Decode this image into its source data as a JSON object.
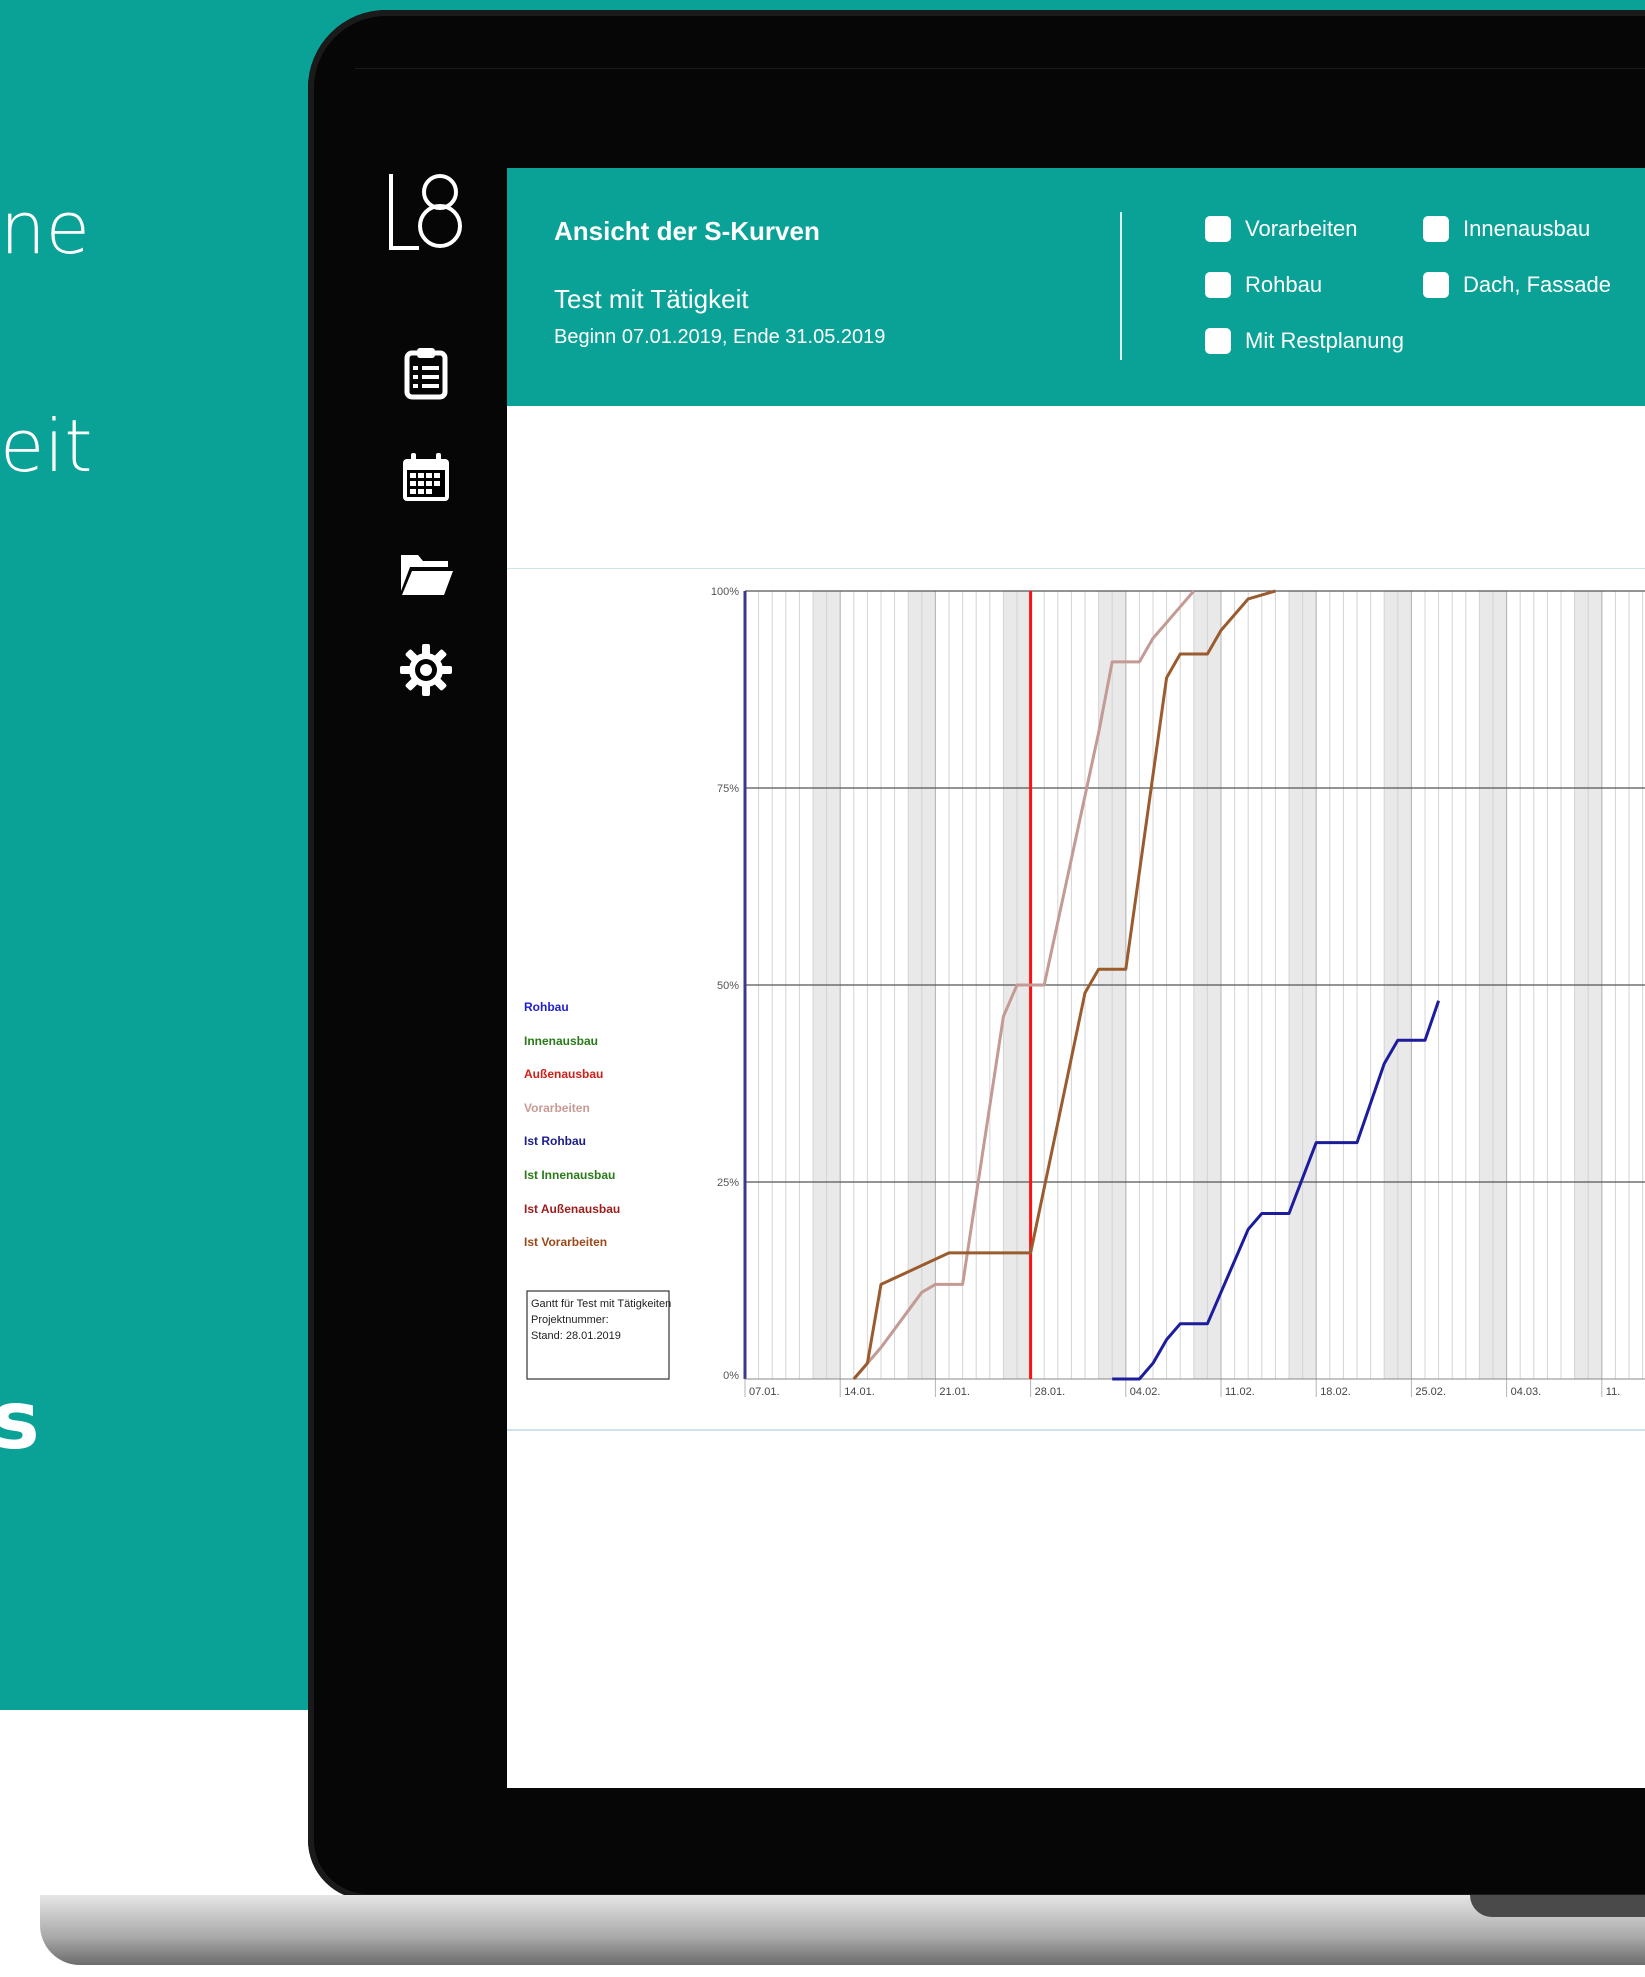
{
  "background_text": {
    "line1": "ne",
    "line2": "eit",
    "line3": "s"
  },
  "header": {
    "title": "Ansicht der S-Kurven",
    "subtitle": "Test mit Tätigkeit",
    "dates": "Beginn 07.01.2019, Ende 31.05.2019"
  },
  "filters": [
    {
      "label": "Vorarbeiten",
      "checked": false
    },
    {
      "label": "Innenausbau",
      "checked": false
    },
    {
      "label": "Rohbau",
      "checked": false
    },
    {
      "label": "Dach, Fassade",
      "checked": false
    },
    {
      "label": "Mit Restplanung",
      "checked": false
    }
  ],
  "nav": {
    "logo": "L8-logo",
    "items": [
      {
        "icon": "clipboard-list-icon"
      },
      {
        "icon": "calendar-icon"
      },
      {
        "icon": "folder-icon"
      },
      {
        "icon": "gear-icon"
      }
    ]
  },
  "chart_data": {
    "type": "line",
    "xlabel": "",
    "ylabel": "",
    "x_ticks": [
      "07.01.",
      "14.01.",
      "21.01.",
      "28.01.",
      "04.02.",
      "11.02.",
      "18.02.",
      "25.02.",
      "04.03.",
      "11."
    ],
    "y_ticks": [
      "0%",
      "25%",
      "50%",
      "75%",
      "100%"
    ],
    "ylim": [
      0,
      100
    ],
    "today_marker": "28.01.",
    "legend": [
      {
        "name": "Rohbau",
        "color": "#1f1fcf"
      },
      {
        "name": "Innenausbau",
        "color": "#2a7a1a"
      },
      {
        "name": "Außenausbau",
        "color": "#d0201a"
      },
      {
        "name": "Vorarbeiten",
        "color": "#c99a96"
      },
      {
        "name": "Ist Rohbau",
        "color": "#1c1c8c"
      },
      {
        "name": "Ist Innenausbau",
        "color": "#2a7a1a"
      },
      {
        "name": "Ist Außenausbau",
        "color": "#9c1c1c"
      },
      {
        "name": "Ist Vorarbeiten",
        "color": "#9a4a1a"
      }
    ],
    "series": [
      {
        "name": "Vorarbeiten",
        "color": "#c49a94",
        "points": [
          [
            8,
            0
          ],
          [
            10,
            4
          ],
          [
            13,
            11
          ],
          [
            14,
            12
          ],
          [
            16,
            12
          ],
          [
            19,
            46
          ],
          [
            20,
            50
          ],
          [
            22,
            50
          ],
          [
            26,
            82
          ],
          [
            27,
            91
          ],
          [
            29,
            91
          ],
          [
            30,
            94
          ],
          [
            32,
            98
          ],
          [
            33,
            100
          ]
        ]
      },
      {
        "name": "Ist Vorarbeiten",
        "color": "#9a5c2e",
        "points": [
          [
            8,
            0
          ],
          [
            9,
            2
          ],
          [
            10,
            12
          ],
          [
            15,
            16
          ],
          [
            20,
            16
          ],
          [
            21,
            16
          ],
          [
            25,
            49
          ],
          [
            26,
            52
          ],
          [
            28,
            52
          ],
          [
            31,
            89
          ],
          [
            32,
            92
          ],
          [
            34,
            92
          ],
          [
            35,
            95
          ],
          [
            37,
            99
          ],
          [
            39,
            100
          ]
        ]
      },
      {
        "name": "Ist Rohbau",
        "color": "#1c1c9c",
        "points": [
          [
            27,
            0
          ],
          [
            29,
            0
          ],
          [
            30,
            2
          ],
          [
            31,
            5
          ],
          [
            32,
            7
          ],
          [
            34,
            7
          ],
          [
            37,
            19
          ],
          [
            38,
            21
          ],
          [
            40,
            21
          ],
          [
            42,
            30
          ],
          [
            45,
            30
          ],
          [
            47,
            40
          ],
          [
            48,
            43
          ],
          [
            50,
            43
          ],
          [
            51,
            48
          ]
        ]
      }
    ],
    "info_box": [
      "Gantt für Test mit Tätigkeiten",
      "Projektnummer:",
      "Stand: 28.01.2019"
    ]
  }
}
